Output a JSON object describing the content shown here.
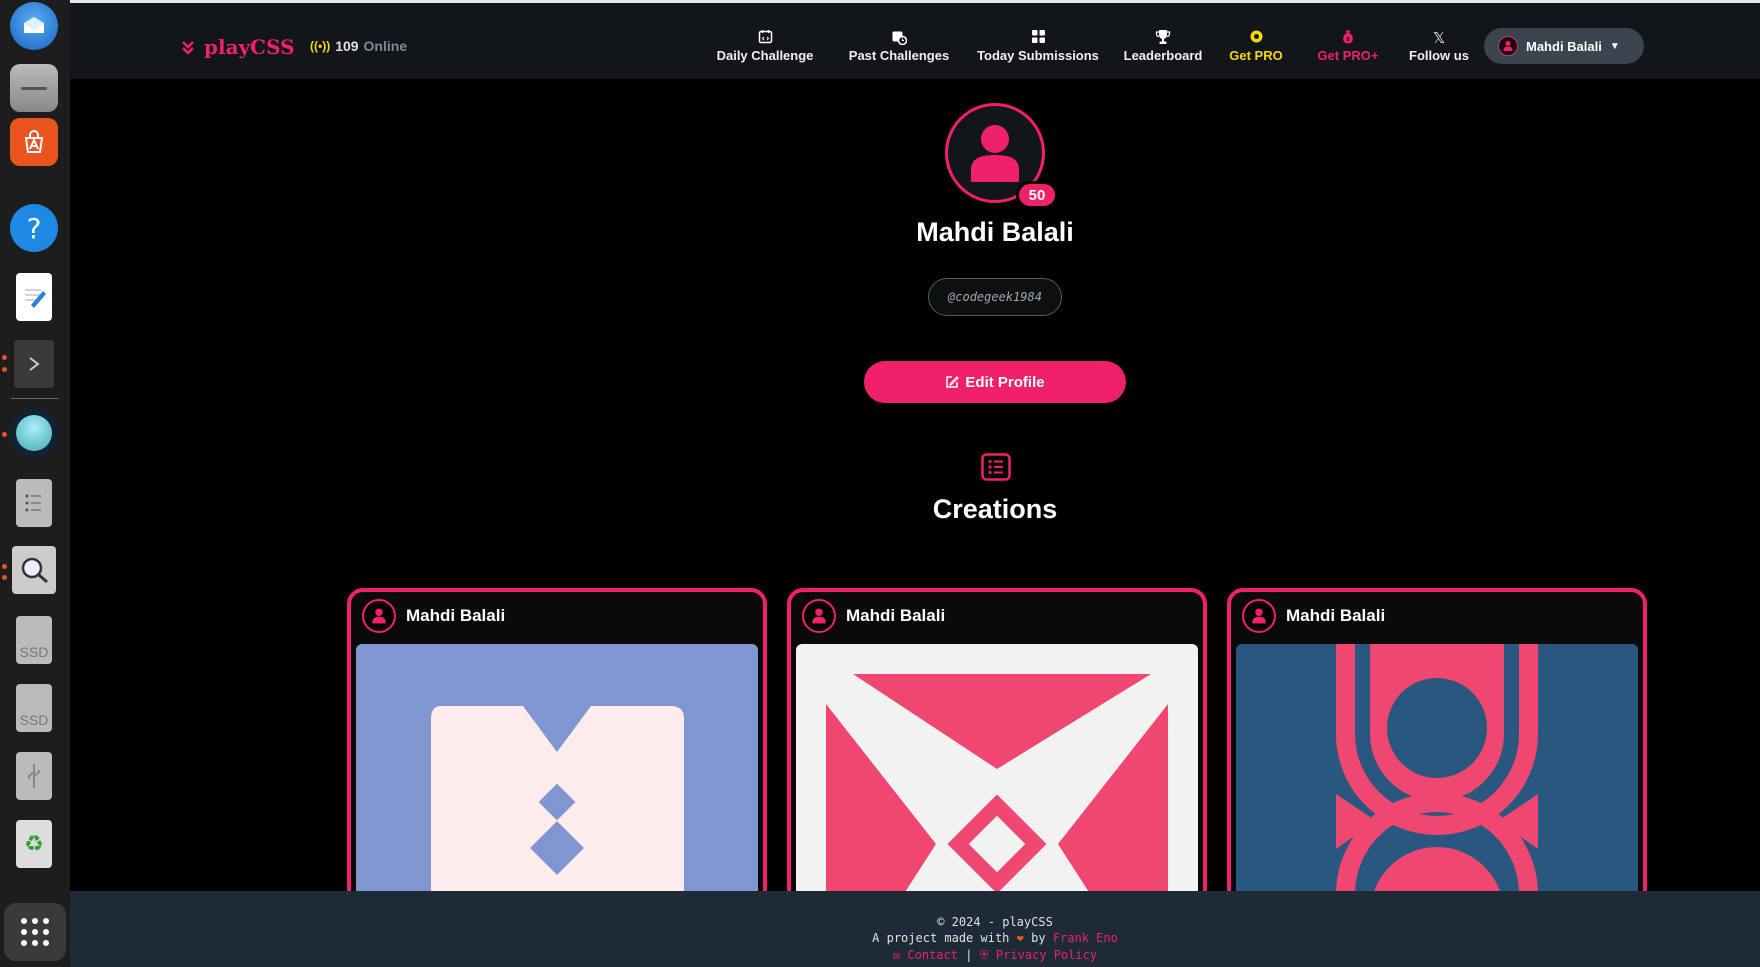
{
  "dock": {
    "items": [
      {
        "name": "thunderbird",
        "icon": "mail-bird-icon"
      },
      {
        "name": "files",
        "icon": "folder-icon"
      },
      {
        "name": "app-center",
        "icon": "store-icon"
      },
      {
        "name": "help",
        "icon": "help-icon"
      },
      {
        "name": "text-editor",
        "icon": "text-editor-icon"
      },
      {
        "name": "terminal",
        "icon": "terminal-icon"
      },
      {
        "name": "app-running",
        "icon": "bubble-app-icon"
      },
      {
        "name": "disk-utility",
        "icon": "disk-utility-icon"
      },
      {
        "name": "image-viewer",
        "icon": "magnifier-icon"
      },
      {
        "name": "ssd-1",
        "icon": "drive-icon",
        "label": "SSD"
      },
      {
        "name": "ssd-2",
        "icon": "drive-icon",
        "label": "SSD"
      },
      {
        "name": "usb",
        "icon": "usb-icon"
      },
      {
        "name": "trash",
        "icon": "trash-icon"
      },
      {
        "name": "show-apps",
        "icon": "app-grid-icon"
      }
    ]
  },
  "navbar": {
    "logo": "playCSS",
    "online_count": "109",
    "online_label": "Online",
    "items": [
      {
        "label": "Daily Challenge",
        "icon": "calendar-code-icon"
      },
      {
        "label": "Past Challenges",
        "icon": "calendar-clock-icon"
      },
      {
        "label": "Today Submissions",
        "icon": "grid-icon"
      },
      {
        "label": "Leaderboard",
        "icon": "trophy-icon"
      },
      {
        "label": "Get PRO",
        "icon": "gear-badge-icon",
        "color": "#f5d90a"
      },
      {
        "label": "Get PRO+",
        "icon": "money-bag-icon",
        "color": "#f0206b"
      },
      {
        "label": "Follow us",
        "icon": "x-logo-icon"
      }
    ],
    "user_name": "Mahdi Balali"
  },
  "profile": {
    "level": "50",
    "name": "Mahdi Balali",
    "handle": "@codegeek1984",
    "edit_label": "Edit Profile"
  },
  "creations": {
    "title": "Creations",
    "cards": [
      {
        "author": "Mahdi Balali",
        "bg": "#7f96d1"
      },
      {
        "author": "Mahdi Balali",
        "bg": "#f2f2f2"
      },
      {
        "author": "Mahdi Balali",
        "bg": "#29577f"
      }
    ]
  },
  "footer": {
    "copyright": "© 2024 - playCSS",
    "made_prefix": "A project made with",
    "made_by": "by",
    "author": "Frank Eno",
    "contact": "Contact",
    "separator": "|",
    "privacy": "Privacy Policy"
  },
  "colors": {
    "accent": "#f0206b",
    "pro": "#f5d90a",
    "navbar": "#121519",
    "footer": "#1e2a35"
  }
}
